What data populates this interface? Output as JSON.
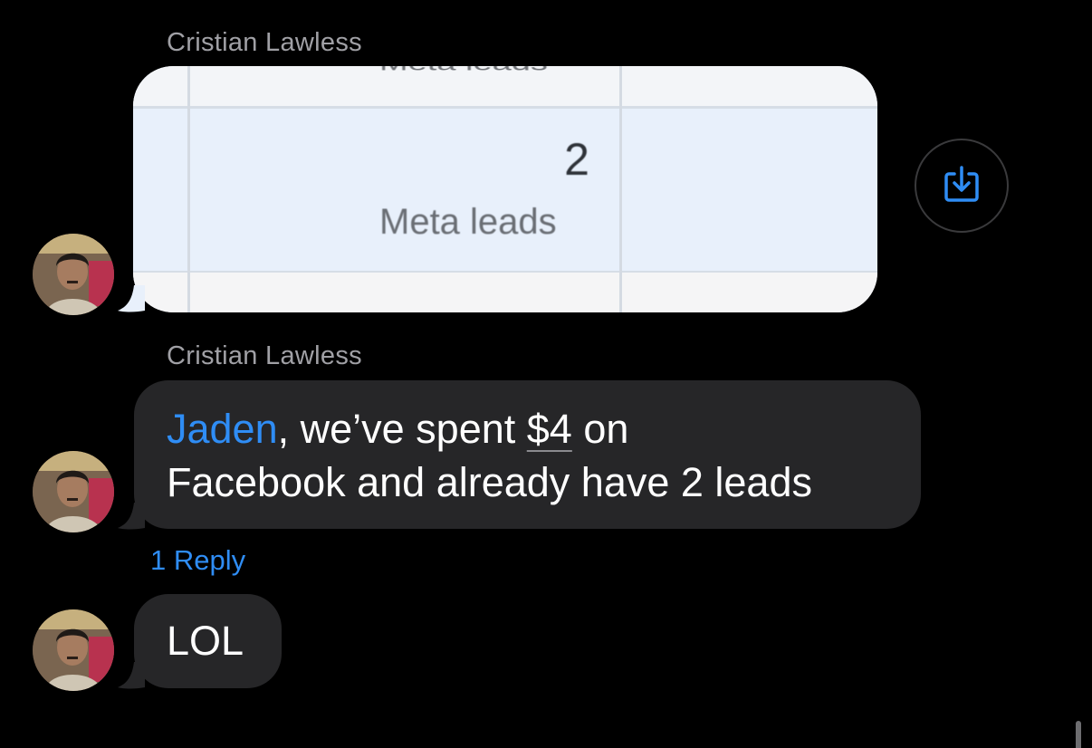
{
  "messages": [
    {
      "sender": "Cristian Lawless",
      "type": "image",
      "image": {
        "cut_label": "Meta leads",
        "value": "2",
        "label": "Meta leads"
      }
    },
    {
      "sender": "Cristian Lawless",
      "type": "text",
      "mention": "Jaden",
      "text_part1": ", we’ve spent ",
      "amount": "$4",
      "text_part2": " on",
      "text_line2": "Facebook and already have 2 leads",
      "reply_count_label": "1 Reply"
    },
    {
      "type": "text",
      "text": "LOL"
    }
  ],
  "icons": {
    "download": "download-icon"
  },
  "colors": {
    "background": "#000000",
    "bubble": "#262628",
    "accent": "#2f8df5",
    "sender_name": "#a0a0a5"
  }
}
